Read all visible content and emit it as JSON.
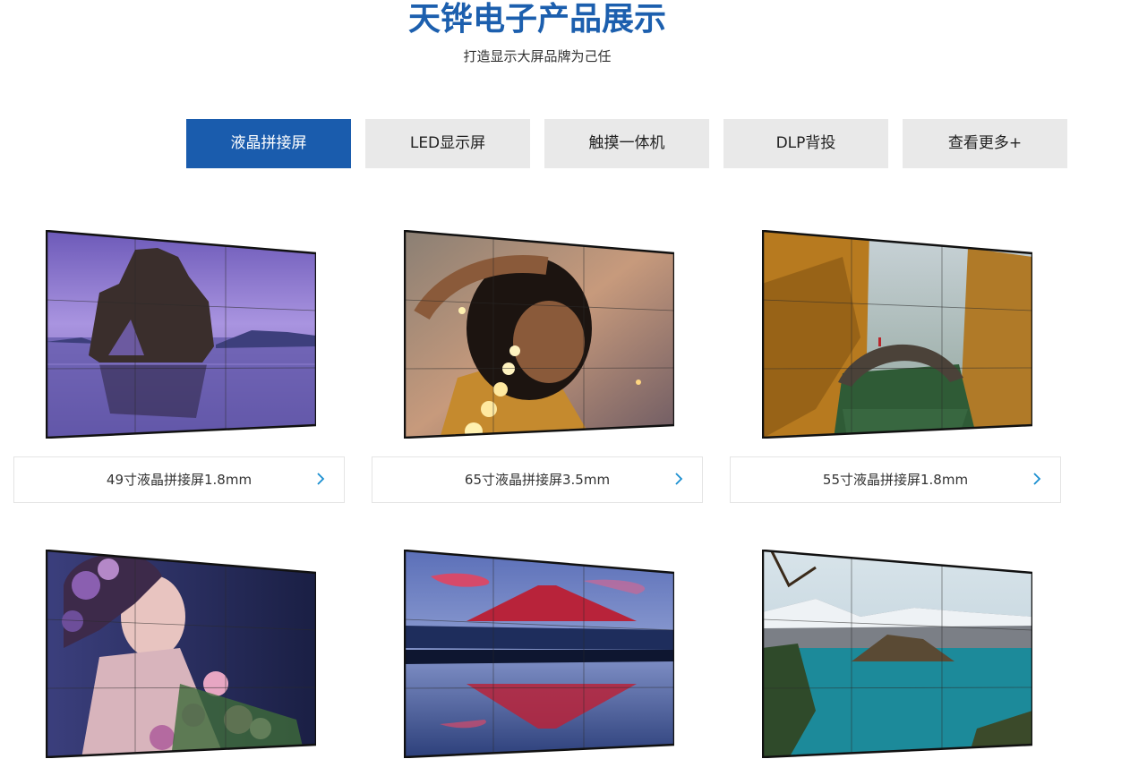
{
  "header": {
    "title": "天铧电子产品展示",
    "subtitle": "打造显示大屏品牌为己任"
  },
  "tabs": [
    {
      "label": "液晶拼接屏",
      "active": true
    },
    {
      "label": "LED显示屏",
      "active": false
    },
    {
      "label": "触摸一体机",
      "active": false
    },
    {
      "label": "DLP背投",
      "active": false
    },
    {
      "label": "查看更多+",
      "active": false
    }
  ],
  "products": [
    {
      "caption": "49寸液晶拼接屏1.8mm",
      "scene": "sea-rock"
    },
    {
      "caption": "65寸液晶拼接屏3.5mm",
      "scene": "woman-lights"
    },
    {
      "caption": "55寸液晶拼接屏1.8mm",
      "scene": "stone-bridge"
    },
    {
      "caption": "",
      "scene": "woman-flowers"
    },
    {
      "caption": "",
      "scene": "mount-fuji"
    },
    {
      "caption": "",
      "scene": "crater-lake"
    }
  ],
  "colors": {
    "brand": "#1c5fae",
    "tab_active": "#1a5cad",
    "tab_inactive": "#e9e9e9",
    "arrow": "#1a8fd0"
  },
  "icons": {
    "caption_arrow": "chevron-right-icon"
  }
}
